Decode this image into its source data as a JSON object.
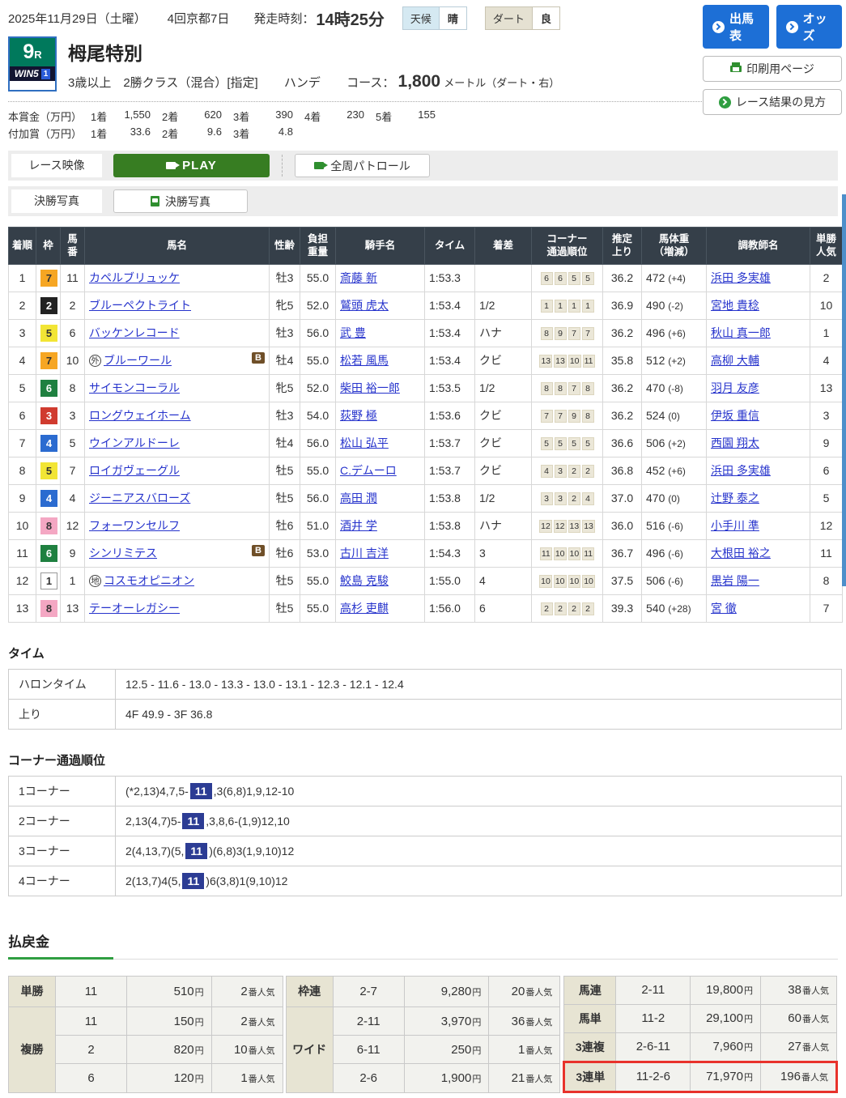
{
  "colors": {
    "accent_blue": "#1d6fd6",
    "accent_green": "#2f9e41",
    "header_dark": "#353f49",
    "highlight_red": "#e8322b",
    "race_badge_green": "#00795c",
    "corner_highlight_blue": "#2c3c94"
  },
  "header": {
    "date": "2025年11月29日（土曜）",
    "meet": "4回京都7日",
    "start_label": "発走時刻：",
    "start_time": "14時25分",
    "weather_label": "天候",
    "weather": "晴",
    "track_label": "ダート",
    "track": "良",
    "btn_entries": "出馬表",
    "btn_odds": "オッズ",
    "btn_print": "印刷用ページ",
    "btn_guide": "レース結果の見方"
  },
  "race": {
    "number": "9",
    "number_suffix": "R",
    "win5": "WIN5",
    "win5_leg": "1",
    "title": "栂尾特別",
    "conditions": "3歳以上　2勝クラス（混合）[指定]",
    "handicap": "ハンデ",
    "course_label": "コース：",
    "distance": "1,800",
    "distance_unit": "メートル（ダート・右）"
  },
  "prize": {
    "main_label": "本賞金（万円）",
    "main": [
      [
        "1着",
        "1,550"
      ],
      [
        "2着",
        "620"
      ],
      [
        "3着",
        "390"
      ],
      [
        "4着",
        "230"
      ],
      [
        "5着",
        "155"
      ]
    ],
    "added_label": "付加賞（万円）",
    "added": [
      [
        "1着",
        "33.6"
      ],
      [
        "2着",
        "9.6"
      ],
      [
        "3着",
        "4.8"
      ]
    ]
  },
  "media": {
    "video_label": "レース映像",
    "play": "PLAY",
    "patrol": "全周パトロール",
    "photo_label": "決勝写真",
    "photo_btn": "決勝写真"
  },
  "results": {
    "headers": {
      "pos": "着順",
      "waku": "枠",
      "num1": "馬",
      "num2": "番",
      "horse": "馬名",
      "sexage": "性齢",
      "load1": "負担",
      "load2": "重量",
      "jockey": "騎手名",
      "time": "タイム",
      "margin": "着差",
      "corner1": "コーナー",
      "corner2": "通過順位",
      "agari1": "推定",
      "agari2": "上り",
      "weight1": "馬体重",
      "weight2": "（増減）",
      "trainer": "調教師名",
      "fav1": "単勝",
      "fav2": "人気"
    },
    "rows": [
      {
        "pos": "1",
        "waku": "7",
        "num": "11",
        "mark": "",
        "horse": "カペルブリュッケ",
        "badge": "",
        "sexage": "牡3",
        "load": "55.0",
        "jockey": "斎藤 新",
        "time": "1:53.3",
        "margin": "",
        "corners": [
          "6",
          "6",
          "5",
          "5"
        ],
        "agari": "36.2",
        "weight": "472",
        "wdiff": "(+4)",
        "trainer": "浜田 多実雄",
        "fav": "2"
      },
      {
        "pos": "2",
        "waku": "2",
        "num": "2",
        "mark": "",
        "horse": "ブルーペクトライト",
        "badge": "",
        "sexage": "牝5",
        "load": "52.0",
        "jockey": "鷲頭 虎太",
        "time": "1:53.4",
        "margin": "1/2",
        "corners": [
          "1",
          "1",
          "1",
          "1"
        ],
        "agari": "36.9",
        "weight": "490",
        "wdiff": "(-2)",
        "trainer": "宮地 貴稔",
        "fav": "10"
      },
      {
        "pos": "3",
        "waku": "5",
        "num": "6",
        "mark": "",
        "horse": "バッケンレコード",
        "badge": "",
        "sexage": "牡3",
        "load": "56.0",
        "jockey": "武 豊",
        "time": "1:53.4",
        "margin": "ハナ",
        "corners": [
          "8",
          "9",
          "7",
          "7"
        ],
        "agari": "36.2",
        "weight": "496",
        "wdiff": "(+6)",
        "trainer": "秋山 真一郎",
        "fav": "1"
      },
      {
        "pos": "4",
        "waku": "7",
        "num": "10",
        "mark": "外",
        "horse": "ブルーワール",
        "badge": "B",
        "sexage": "牡4",
        "load": "55.0",
        "jockey": "松若 風馬",
        "time": "1:53.4",
        "margin": "クビ",
        "corners": [
          "13",
          "13",
          "10",
          "11"
        ],
        "agari": "35.8",
        "weight": "512",
        "wdiff": "(+2)",
        "trainer": "高柳 大輔",
        "fav": "4"
      },
      {
        "pos": "5",
        "waku": "6",
        "num": "8",
        "mark": "",
        "horse": "サイモンコーラル",
        "badge": "",
        "sexage": "牝5",
        "load": "52.0",
        "jockey": "柴田 裕一郎",
        "time": "1:53.5",
        "margin": "1/2",
        "corners": [
          "8",
          "8",
          "7",
          "8"
        ],
        "agari": "36.2",
        "weight": "470",
        "wdiff": "(-8)",
        "trainer": "羽月 友彦",
        "fav": "13"
      },
      {
        "pos": "6",
        "waku": "3",
        "num": "3",
        "mark": "",
        "horse": "ロングウェイホーム",
        "badge": "",
        "sexage": "牡3",
        "load": "54.0",
        "jockey": "荻野 極",
        "time": "1:53.6",
        "margin": "クビ",
        "corners": [
          "7",
          "7",
          "9",
          "8"
        ],
        "agari": "36.2",
        "weight": "524",
        "wdiff": "(0)",
        "trainer": "伊坂 重信",
        "fav": "3"
      },
      {
        "pos": "7",
        "waku": "4",
        "num": "5",
        "mark": "",
        "horse": "ウインアルドーレ",
        "badge": "",
        "sexage": "牡4",
        "load": "56.0",
        "jockey": "松山 弘平",
        "time": "1:53.7",
        "margin": "クビ",
        "corners": [
          "5",
          "5",
          "5",
          "5"
        ],
        "agari": "36.6",
        "weight": "506",
        "wdiff": "(+2)",
        "trainer": "西園 翔太",
        "fav": "9"
      },
      {
        "pos": "8",
        "waku": "5",
        "num": "7",
        "mark": "",
        "horse": "ロイガヴェーグル",
        "badge": "",
        "sexage": "牡5",
        "load": "55.0",
        "jockey": "C.デムーロ",
        "time": "1:53.7",
        "margin": "クビ",
        "corners": [
          "4",
          "3",
          "2",
          "2"
        ],
        "agari": "36.8",
        "weight": "452",
        "wdiff": "(+6)",
        "trainer": "浜田 多実雄",
        "fav": "6"
      },
      {
        "pos": "9",
        "waku": "4",
        "num": "4",
        "mark": "",
        "horse": "ジーニアスバローズ",
        "badge": "",
        "sexage": "牡5",
        "load": "56.0",
        "jockey": "高田 潤",
        "time": "1:53.8",
        "margin": "1/2",
        "corners": [
          "3",
          "3",
          "2",
          "4"
        ],
        "agari": "37.0",
        "weight": "470",
        "wdiff": "(0)",
        "trainer": "辻野 泰之",
        "fav": "5"
      },
      {
        "pos": "10",
        "waku": "8",
        "num": "12",
        "mark": "",
        "horse": "フォーワンセルフ",
        "badge": "",
        "sexage": "牡6",
        "load": "51.0",
        "jockey": "酒井 学",
        "time": "1:53.8",
        "margin": "ハナ",
        "corners": [
          "12",
          "12",
          "13",
          "13"
        ],
        "agari": "36.0",
        "weight": "516",
        "wdiff": "(-6)",
        "trainer": "小手川 準",
        "fav": "12"
      },
      {
        "pos": "11",
        "waku": "6",
        "num": "9",
        "mark": "",
        "horse": "シンリミテス",
        "badge": "B",
        "sexage": "牡6",
        "load": "53.0",
        "jockey": "古川 吉洋",
        "time": "1:54.3",
        "margin": "3",
        "corners": [
          "11",
          "10",
          "10",
          "11"
        ],
        "agari": "36.7",
        "weight": "496",
        "wdiff": "(-6)",
        "trainer": "大根田 裕之",
        "fav": "11"
      },
      {
        "pos": "12",
        "waku": "1",
        "num": "1",
        "mark": "地",
        "horse": "コスモオピニオン",
        "badge": "",
        "sexage": "牡5",
        "load": "55.0",
        "jockey": "鮫島 克駿",
        "time": "1:55.0",
        "margin": "4",
        "corners": [
          "10",
          "10",
          "10",
          "10"
        ],
        "agari": "37.5",
        "weight": "506",
        "wdiff": "(-6)",
        "trainer": "黒岩 陽一",
        "fav": "8"
      },
      {
        "pos": "13",
        "waku": "8",
        "num": "13",
        "mark": "",
        "horse": "テーオーレガシー",
        "badge": "",
        "sexage": "牡5",
        "load": "55.0",
        "jockey": "高杉 吏麒",
        "time": "1:56.0",
        "margin": "6",
        "corners": [
          "2",
          "2",
          "2",
          "2"
        ],
        "agari": "39.3",
        "weight": "540",
        "wdiff": "(+28)",
        "trainer": "宮 徹",
        "fav": "7"
      }
    ]
  },
  "time_section": {
    "heading": "タイム",
    "furlong_label": "ハロンタイム",
    "furlong": "12.5 - 11.6 - 13.0 - 13.3 - 13.0 - 13.1 - 12.3 - 12.1 - 12.4",
    "agari_label": "上り",
    "agari": "4F 49.9 - 3F 36.8"
  },
  "corner_section": {
    "heading": "コーナー通過順位",
    "rows": [
      {
        "label": "1コーナー",
        "pre": "(*2,13)4,7,5-",
        "hl": "11",
        "post": ",3(6,8)1,9,12-10"
      },
      {
        "label": "2コーナー",
        "pre": "2,13(4,7)5-",
        "hl": "11",
        "post": ",3,8,6-(1,9)12,10"
      },
      {
        "label": "3コーナー",
        "pre": "2(4,13,7)(5,",
        "hl": "11",
        "post": ")(6,8)3(1,9,10)12"
      },
      {
        "label": "4コーナー",
        "pre": "2(13,7)4(5,",
        "hl": "11",
        "post": ")6(3,8)1(9,10)12"
      }
    ]
  },
  "payout": {
    "heading": "払戻金",
    "yen": "円",
    "ninki_suffix": "番人気",
    "tansho": {
      "label": "単勝",
      "combo": "11",
      "amount": "510",
      "rank": "2"
    },
    "fukusho": {
      "label": "複勝",
      "rows": [
        {
          "combo": "11",
          "amount": "150",
          "rank": "2"
        },
        {
          "combo": "2",
          "amount": "820",
          "rank": "10"
        },
        {
          "combo": "6",
          "amount": "120",
          "rank": "1"
        }
      ]
    },
    "wakuren": {
      "label": "枠連",
      "combo": "2-7",
      "amount": "9,280",
      "rank": "20"
    },
    "wide": {
      "label": "ワイド",
      "rows": [
        {
          "combo": "2-11",
          "amount": "3,970",
          "rank": "36"
        },
        {
          "combo": "6-11",
          "amount": "250",
          "rank": "1"
        },
        {
          "combo": "2-6",
          "amount": "1,900",
          "rank": "21"
        }
      ]
    },
    "umaren": {
      "label": "馬連",
      "combo": "2-11",
      "amount": "19,800",
      "rank": "38"
    },
    "umatan": {
      "label": "馬単",
      "combo": "11-2",
      "amount": "29,100",
      "rank": "60"
    },
    "sanrenpuku": {
      "label": "3連複",
      "combo": "2-6-11",
      "amount": "7,960",
      "rank": "27"
    },
    "sanrentan": {
      "label": "3連単",
      "combo": "11-2-6",
      "amount": "71,970",
      "rank": "196"
    }
  }
}
